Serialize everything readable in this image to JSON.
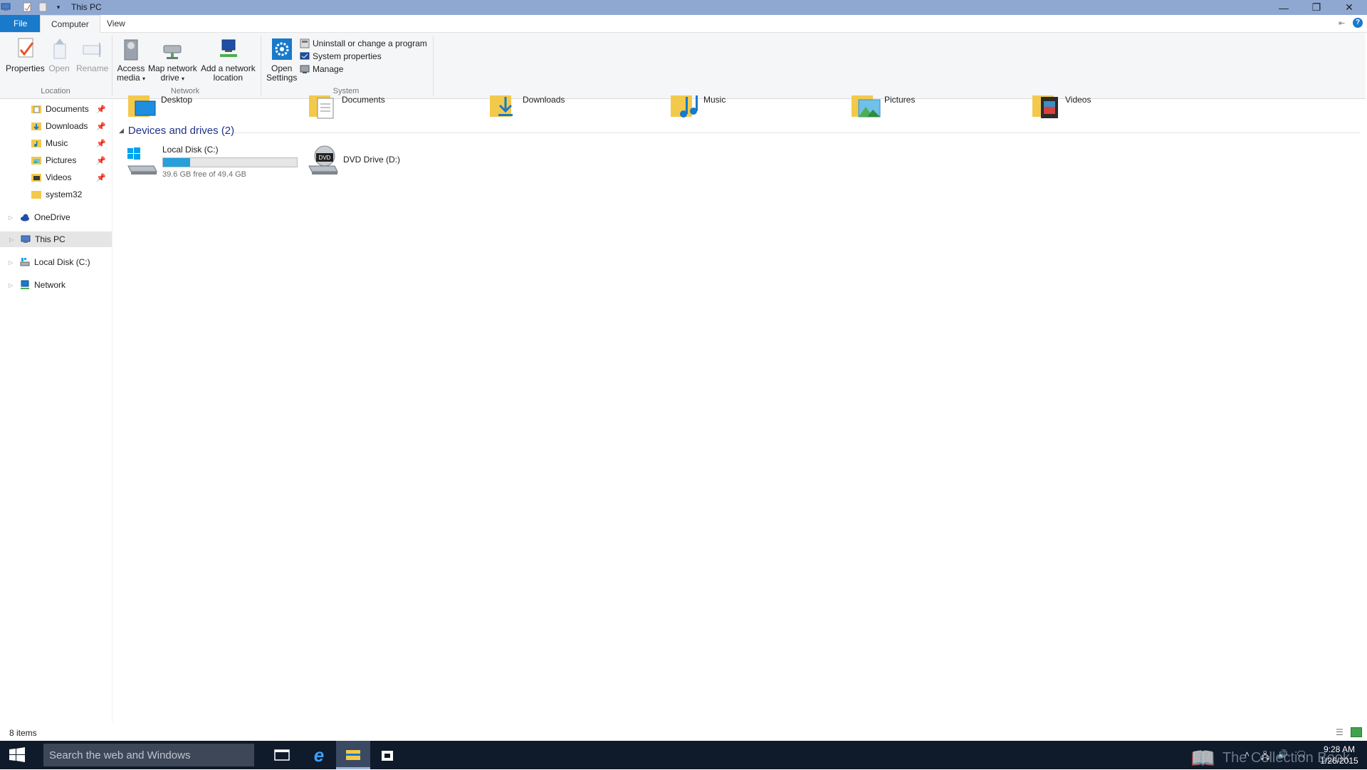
{
  "window": {
    "title": "This PC",
    "controls": {
      "minimize": "—",
      "restore": "❐",
      "close": "✕"
    }
  },
  "ribbon": {
    "tabs": [
      "File",
      "Computer",
      "View"
    ],
    "groups": {
      "location": {
        "label": "Location",
        "buttons": [
          {
            "label": "Properties"
          },
          {
            "label": "Open"
          },
          {
            "label": "Rename"
          }
        ]
      },
      "network": {
        "label": "Network",
        "buttons": [
          {
            "label_line1": "Access",
            "label_line2": "media"
          },
          {
            "label_line1": "Map network",
            "label_line2": "drive"
          },
          {
            "label_line1": "Add a network",
            "label_line2": "location"
          }
        ]
      },
      "system": {
        "label": "System",
        "open_settings_line1": "Open",
        "open_settings_line2": "Settings",
        "small_buttons": [
          "Uninstall or change a program",
          "System properties",
          "Manage"
        ]
      }
    }
  },
  "navigation": {
    "quick_access": [
      {
        "label": "Documents",
        "pinned": true
      },
      {
        "label": "Downloads",
        "pinned": true
      },
      {
        "label": "Music",
        "pinned": true
      },
      {
        "label": "Pictures",
        "pinned": true
      },
      {
        "label": "Videos",
        "pinned": true
      },
      {
        "label": "system32",
        "pinned": false
      }
    ],
    "roots": [
      "OneDrive",
      "This PC",
      "Local Disk (C:)",
      "Network"
    ]
  },
  "content": {
    "folders": [
      "Desktop",
      "Documents",
      "Downloads",
      "Music",
      "Pictures",
      "Videos"
    ],
    "devices_section_title": "Devices and drives (2)",
    "drives": [
      {
        "name": "Local Disk (C:)",
        "free_text": "39.6 GB free of 49.4 GB",
        "used_fraction": 0.2
      },
      {
        "name": "DVD Drive (D:)"
      }
    ]
  },
  "status": {
    "items_text": "8 items"
  },
  "taskbar": {
    "search_placeholder": "Search the web and Windows",
    "time": "9:28 AM",
    "date": "1/26/2015",
    "watermark": "The Collection Book"
  },
  "colors": {
    "titlebar": "#8fa8d2",
    "file_tab": "#1979ca",
    "section_title": "#1e3287",
    "usage_fill": "#26a0da",
    "taskbar": "#0f1a2b"
  }
}
